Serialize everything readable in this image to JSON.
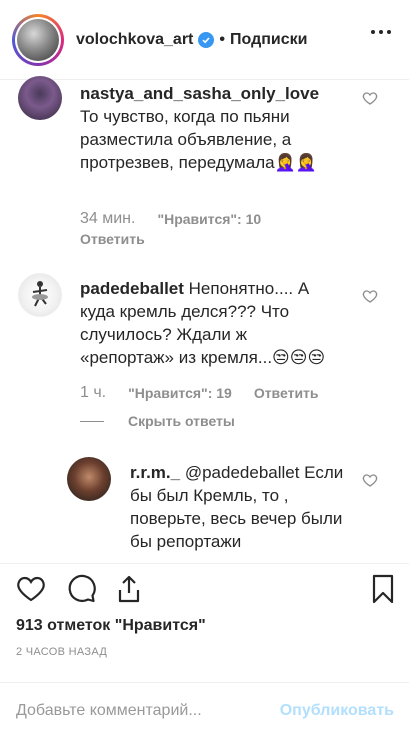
{
  "header": {
    "username": "volochkova_art",
    "dot": "•",
    "follow_status": "Подписки"
  },
  "comments": [
    {
      "username": "nastya_and_sasha_only_love",
      "text": " То чувство, когда по пьяни разместила объявление, а протрезвев, передумала🤦‍♀️🤦‍♀️",
      "time": "34 мин.",
      "likes": "\"Нравится\": 10",
      "reply": "Ответить"
    },
    {
      "username": "padedeballet",
      "text": " Непонятно.... А куда кремль делся??? Что случилось? Ждали ж «репортаж» из кремля...😒😒😒",
      "time": "1 ч.",
      "likes": "\"Нравится\": 19",
      "reply": "Ответить"
    },
    {
      "username": "r.r.m._",
      "text": " @padedeballet Если бы был Кремль, то , поверьте, весь вечер были бы репортажи"
    }
  ],
  "hide_replies": "Скрыть ответы",
  "post": {
    "likes_count": "913 отметок \"Нравится\"",
    "time_ago": "2 ЧАСОВ НАЗАД"
  },
  "add_comment": {
    "placeholder": "Добавьте комментарий...",
    "publish": "Опубликовать"
  },
  "colors": {
    "verified": "#3897f0",
    "publish_disabled": "#b2dffc",
    "meta_gray": "#8e8e8e"
  }
}
